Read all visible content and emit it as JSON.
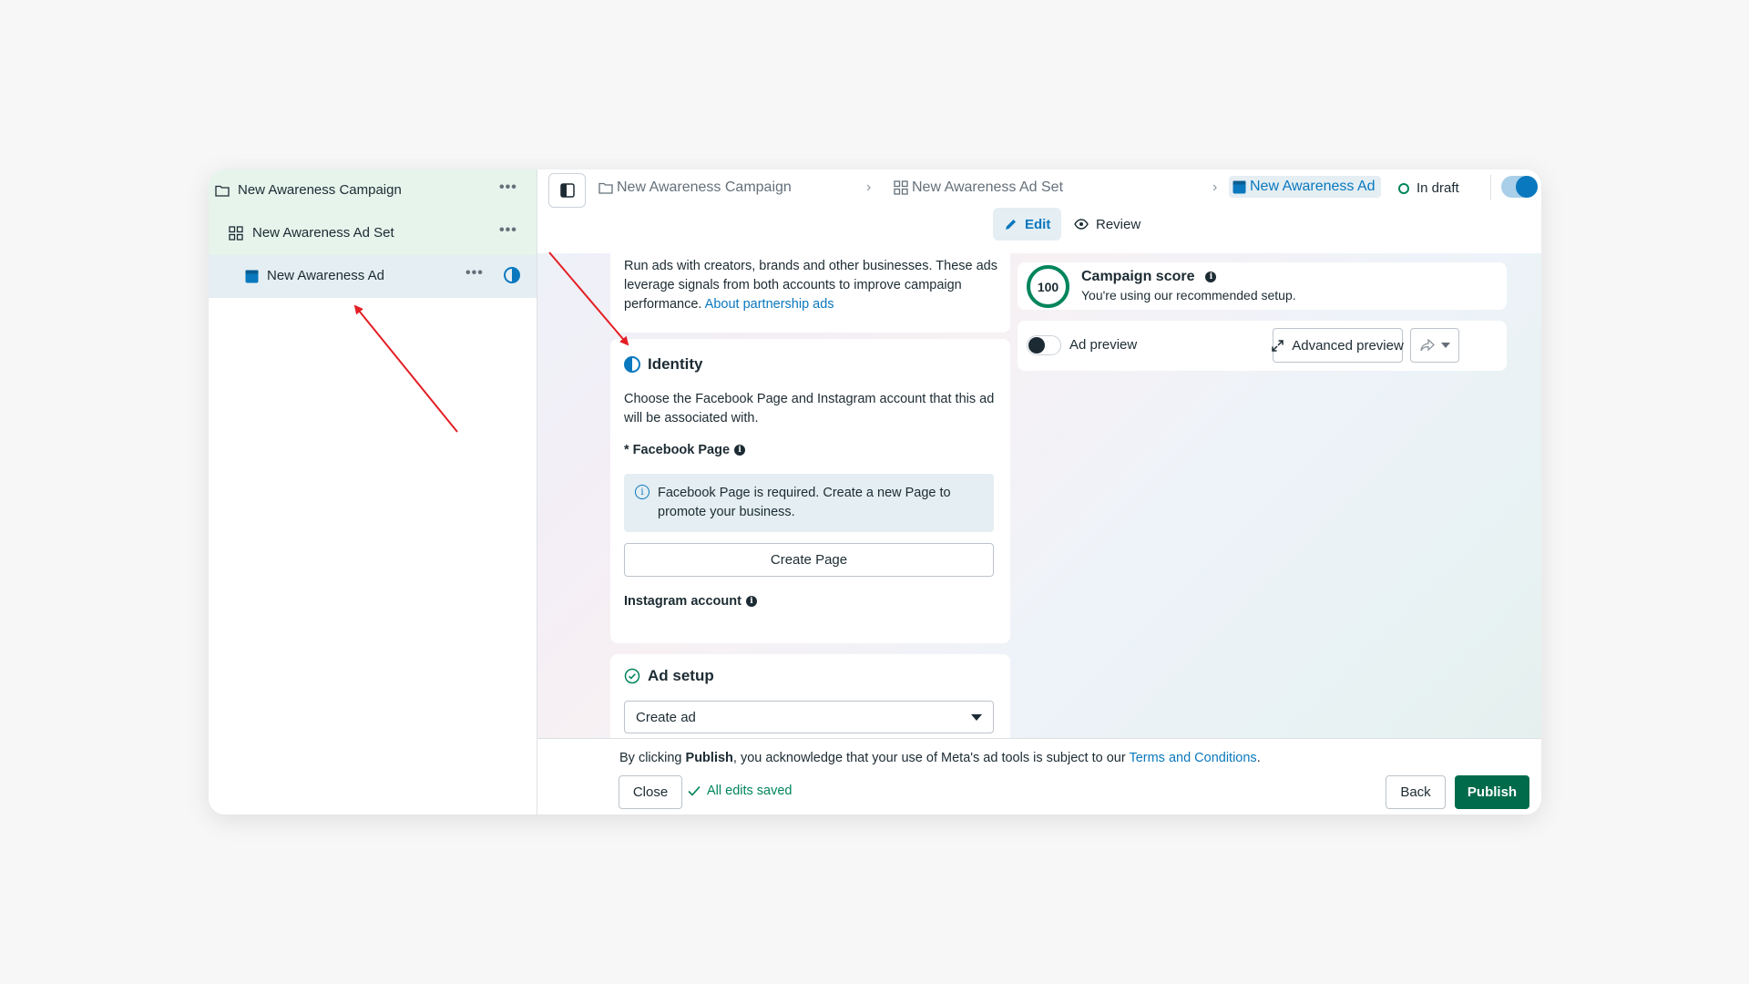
{
  "sidebar": {
    "items": [
      {
        "label": "New Awareness Campaign",
        "icon": "folder-icon"
      },
      {
        "label": "New Awareness Ad Set",
        "icon": "grid-icon"
      },
      {
        "label": "New Awareness Ad",
        "icon": "ad-icon"
      }
    ],
    "more": "•••"
  },
  "header": {
    "breadcrumb": [
      "New Awareness Campaign",
      "New Awareness Ad Set",
      "New Awareness Ad"
    ],
    "separator": "›",
    "status": "In draft",
    "tabs": {
      "edit": "Edit",
      "review": "Review"
    }
  },
  "partnership": {
    "text": "Run ads with creators, brands and other businesses. These ads leverage signals from both accounts to improve campaign performance.",
    "link": "About partnership ads"
  },
  "identity": {
    "title": "Identity",
    "description": "Choose the Facebook Page and Instagram account that this ad will be associated with.",
    "facebook_label": "* Facebook Page",
    "notice": "Facebook Page is required. Create a new Page to promote your business.",
    "create_page": "Create Page",
    "instagram_label": "Instagram account"
  },
  "ad_setup": {
    "title": "Ad setup",
    "select_value": "Create ad"
  },
  "score": {
    "value": "100",
    "title": "Campaign score",
    "subtitle": "You're using our recommended setup."
  },
  "preview": {
    "label": "Ad preview",
    "advanced": "Advanced preview"
  },
  "footer": {
    "prefix": "By clicking ",
    "publish_word": "Publish",
    "middle": ", you acknowledge that your use of Meta's ad tools is subject to our ",
    "terms": "Terms and Conditions",
    "suffix": ".",
    "close": "Close",
    "saved": "All edits saved",
    "back": "Back",
    "publish": "Publish"
  },
  "colors": {
    "accent": "#0a78be",
    "green": "#006b4a",
    "annotation": "#e31e24"
  }
}
